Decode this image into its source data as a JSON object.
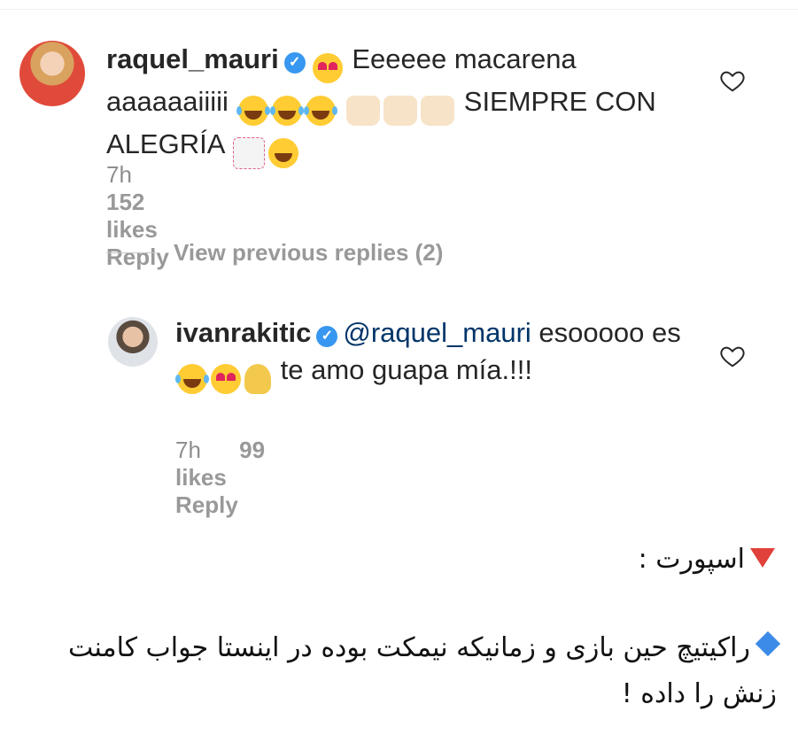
{
  "comments": [
    {
      "username": "raquel_mauri",
      "mention": "",
      "text_a": "Eeeeee macarena aaaaaaiiiii",
      "text_b": "SIEMPRE CON ALEGRÍA",
      "time": "7h",
      "likes": "152 likes",
      "reply": "Reply"
    },
    {
      "username": "ivanrakitic",
      "mention": "@raquel_mauri",
      "text_a": "esooooo es",
      "text_b": "te amo guapa mía.!!!",
      "time": "7h",
      "likes": "99 likes",
      "reply": "Reply"
    }
  ],
  "view_previous": "View previous replies (2)",
  "caption": {
    "line1": "اسپورت :",
    "line2": "راکیتیچ حین بازی و زمانیکه نیمکت بوده در اینستا جواب کامنت زنش را داده !"
  },
  "colors": {
    "text": "#262626",
    "meta": "#8e8e8e",
    "verified": "#3897f0",
    "mention": "#003569",
    "red_triangle": "#e0413a",
    "blue_diamond": "#3d8be8"
  },
  "icons": [
    "verified-badge-icon",
    "heart-outline-icon",
    "red-triangle-icon",
    "blue-diamond-icon"
  ]
}
